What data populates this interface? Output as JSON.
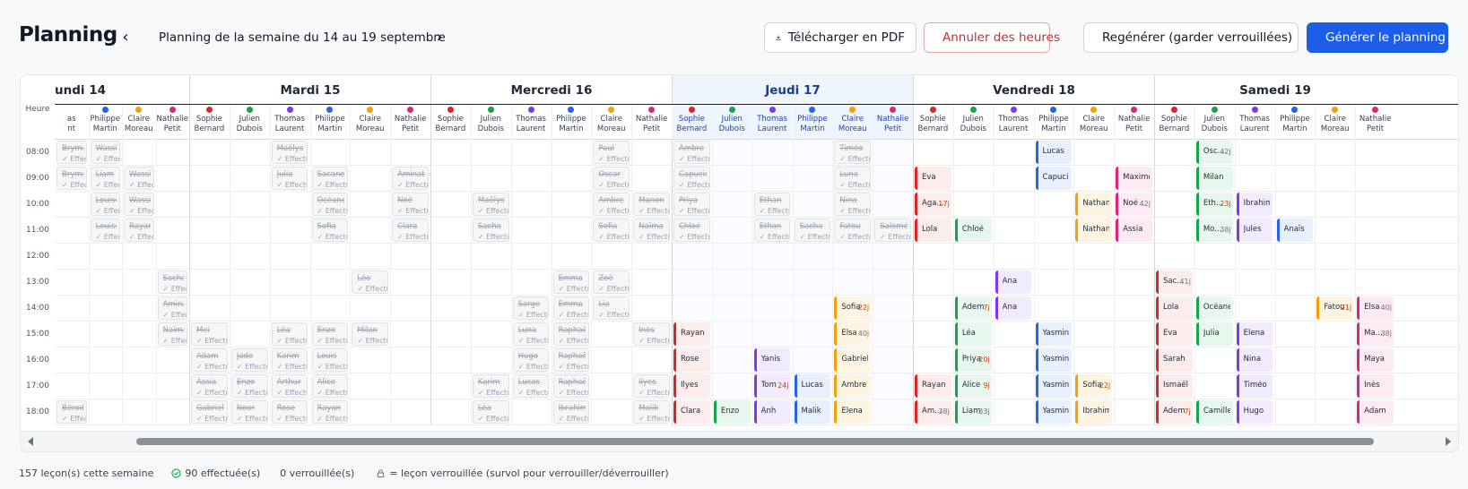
{
  "header": {
    "title": "Planning",
    "week_label": "Planning de la semaine du 14 au 19 septembre",
    "download_label": "Télécharger en PDF",
    "cancel_label": "Annuler des heures",
    "regen_label": "Regénérer (garder verrouillées)",
    "generate_label": "Générer le planning"
  },
  "colors": {
    "primary": "#1d5ee8",
    "danger": "#c53030"
  },
  "grid": {
    "heure_label": "Heure",
    "times": [
      "08:00",
      "09:00",
      "10:00",
      "11:00",
      "12:00",
      "13:00",
      "14:00",
      "15:00",
      "16:00",
      "17:00",
      "18:00"
    ],
    "done_label": "Effectu",
    "days": [
      {
        "label": "undi 14",
        "today": false
      },
      {
        "label": "Mardi 15",
        "today": false
      },
      {
        "label": "Mercredi 16",
        "today": false
      },
      {
        "label": "Jeudi 17",
        "today": true
      },
      {
        "label": "Vendredi 18",
        "today": false
      },
      {
        "label": "Samedi 19",
        "today": false
      }
    ],
    "instructors": [
      {
        "first": "Sophie",
        "last": "Bernard",
        "color": "#dc2626"
      },
      {
        "first": "Julien",
        "last": "Dubois",
        "color": "#16a34a"
      },
      {
        "first": "Thomas",
        "last": "Laurent",
        "color": "#7c3aed"
      },
      {
        "first": "Philippe",
        "last": "Martin",
        "color": "#2563eb"
      },
      {
        "first": "Claire",
        "last": "Moreau",
        "color": "#f59e0b"
      },
      {
        "first": "Nathalie",
        "last": "Petit",
        "color": "#db2777"
      }
    ],
    "monday_partial": [
      {
        "first": "",
        "last": "",
        "color": ""
      },
      {
        "first": "Philippe",
        "last": "Martin",
        "color": "#2563eb"
      },
      {
        "first": "Claire",
        "last": "Moreau",
        "color": "#f59e0b"
      },
      {
        "first": "Nathalie",
        "last": "Petit",
        "color": "#db2777"
      }
    ],
    "monday_first_partial": {
      "first": "as",
      "last": "nt"
    },
    "done_lessons": [
      {
        "day": 0,
        "col": 0,
        "row": 0,
        "name": "Bryme"
      },
      {
        "day": 0,
        "col": 1,
        "row": 0,
        "name": "Wassim"
      },
      {
        "day": 0,
        "col": 0,
        "row": 1,
        "name": "Bryme"
      },
      {
        "day": 0,
        "col": 1,
        "row": 1,
        "name": "Liam"
      },
      {
        "day": 0,
        "col": 2,
        "row": 1,
        "name": "Wassim"
      },
      {
        "day": 0,
        "col": 1,
        "row": 2,
        "name": "Louise"
      },
      {
        "day": 0,
        "col": 2,
        "row": 2,
        "name": "Wassim"
      },
      {
        "day": 0,
        "col": 1,
        "row": 3,
        "name": "Louise"
      },
      {
        "day": 0,
        "col": 2,
        "row": 3,
        "name": "Rayan"
      },
      {
        "day": 0,
        "col": 3,
        "row": 5,
        "name": "Sacha"
      },
      {
        "day": 0,
        "col": 3,
        "row": 6,
        "name": "Aminata"
      },
      {
        "day": 0,
        "col": 3,
        "row": 7,
        "name": "Naïma"
      },
      {
        "day": 0,
        "col": 0,
        "row": 10,
        "name": "Bérod"
      },
      {
        "day": 1,
        "col": 2,
        "row": 0,
        "name": "Maëlys"
      },
      {
        "day": 1,
        "col": 2,
        "row": 1,
        "name": "Julia"
      },
      {
        "day": 1,
        "col": 3,
        "row": 1,
        "name": "Sacane"
      },
      {
        "day": 1,
        "col": 5,
        "row": 1,
        "name": "Aminata"
      },
      {
        "day": 1,
        "col": 3,
        "row": 2,
        "name": "Océane"
      },
      {
        "day": 1,
        "col": 5,
        "row": 2,
        "name": "Noé"
      },
      {
        "day": 1,
        "col": 3,
        "row": 3,
        "name": "Sofia"
      },
      {
        "day": 1,
        "col": 5,
        "row": 3,
        "name": "Clara"
      },
      {
        "day": 1,
        "col": 4,
        "row": 5,
        "name": "Léo"
      },
      {
        "day": 1,
        "col": 0,
        "row": 7,
        "name": "Mei"
      },
      {
        "day": 1,
        "col": 2,
        "row": 7,
        "name": "Léa"
      },
      {
        "day": 1,
        "col": 3,
        "row": 7,
        "name": "Enzo"
      },
      {
        "day": 1,
        "col": 4,
        "row": 7,
        "name": "Milan"
      },
      {
        "day": 1,
        "col": 0,
        "row": 8,
        "name": "Adam"
      },
      {
        "day": 1,
        "col": 1,
        "row": 8,
        "name": "Jade"
      },
      {
        "day": 1,
        "col": 2,
        "row": 8,
        "name": "Karim"
      },
      {
        "day": 1,
        "col": 3,
        "row": 8,
        "name": "Louis"
      },
      {
        "day": 1,
        "col": 0,
        "row": 9,
        "name": "Assia"
      },
      {
        "day": 1,
        "col": 1,
        "row": 9,
        "name": "Enzo"
      },
      {
        "day": 1,
        "col": 2,
        "row": 9,
        "name": "Arthur"
      },
      {
        "day": 1,
        "col": 3,
        "row": 9,
        "name": "Alice"
      },
      {
        "day": 1,
        "col": 0,
        "row": 10,
        "name": "Gabriel"
      },
      {
        "day": 1,
        "col": 1,
        "row": 10,
        "name": "Noor"
      },
      {
        "day": 1,
        "col": 2,
        "row": 10,
        "name": "Rose"
      },
      {
        "day": 1,
        "col": 3,
        "row": 10,
        "name": "Rayan"
      },
      {
        "day": 2,
        "col": 4,
        "row": 0,
        "name": "Paul"
      },
      {
        "day": 2,
        "col": 4,
        "row": 1,
        "name": "Oscar"
      },
      {
        "day": 2,
        "col": 1,
        "row": 2,
        "name": "Maëlys"
      },
      {
        "day": 2,
        "col": 4,
        "row": 2,
        "name": "Ambre"
      },
      {
        "day": 2,
        "col": 5,
        "row": 2,
        "name": "Manon"
      },
      {
        "day": 2,
        "col": 1,
        "row": 3,
        "name": "Sacha"
      },
      {
        "day": 2,
        "col": 4,
        "row": 3,
        "name": "Sofia"
      },
      {
        "day": 2,
        "col": 5,
        "row": 3,
        "name": "Naïma"
      },
      {
        "day": 2,
        "col": 3,
        "row": 5,
        "name": "Emma"
      },
      {
        "day": 2,
        "col": 4,
        "row": 5,
        "name": "Zoé"
      },
      {
        "day": 2,
        "col": 2,
        "row": 6,
        "name": "Sarge"
      },
      {
        "day": 2,
        "col": 3,
        "row": 6,
        "name": "Emma"
      },
      {
        "day": 2,
        "col": 4,
        "row": 6,
        "name": "Lia"
      },
      {
        "day": 2,
        "col": 2,
        "row": 7,
        "name": "Luna"
      },
      {
        "day": 2,
        "col": 3,
        "row": 7,
        "name": "Raphaël"
      },
      {
        "day": 2,
        "col": 5,
        "row": 7,
        "name": "Inès"
      },
      {
        "day": 2,
        "col": 2,
        "row": 8,
        "name": "Hugo"
      },
      {
        "day": 2,
        "col": 3,
        "row": 8,
        "name": "Raphaël"
      },
      {
        "day": 2,
        "col": 1,
        "row": 9,
        "name": "Karim"
      },
      {
        "day": 2,
        "col": 2,
        "row": 9,
        "name": "Lucas"
      },
      {
        "day": 2,
        "col": 3,
        "row": 9,
        "name": "Raphaël"
      },
      {
        "day": 2,
        "col": 5,
        "row": 9,
        "name": "Ilyes"
      },
      {
        "day": 2,
        "col": 1,
        "row": 10,
        "name": "Léa"
      },
      {
        "day": 2,
        "col": 3,
        "row": 10,
        "name": "Ibrahim"
      },
      {
        "day": 2,
        "col": 5,
        "row": 10,
        "name": "Malik"
      },
      {
        "day": 3,
        "col": 0,
        "row": 0,
        "name": "Ambre"
      },
      {
        "day": 3,
        "col": 4,
        "row": 0,
        "name": "Timéo"
      },
      {
        "day": 3,
        "col": 0,
        "row": 1,
        "name": "Capucine"
      },
      {
        "day": 3,
        "col": 4,
        "row": 1,
        "name": "Luna"
      },
      {
        "day": 3,
        "col": 0,
        "row": 2,
        "name": "Priya"
      },
      {
        "day": 3,
        "col": 2,
        "row": 2,
        "name": "Ethan"
      },
      {
        "day": 3,
        "col": 4,
        "row": 2,
        "name": "Nina"
      },
      {
        "day": 3,
        "col": 0,
        "row": 3,
        "name": "Chloé"
      },
      {
        "day": 3,
        "col": 2,
        "row": 3,
        "name": "Ethan"
      },
      {
        "day": 3,
        "col": 3,
        "row": 3,
        "name": "Sacha"
      },
      {
        "day": 3,
        "col": 4,
        "row": 3,
        "name": "Fatou"
      },
      {
        "day": 3,
        "col": 5,
        "row": 3,
        "name": "Salomé"
      }
    ],
    "active_lessons": [
      {
        "day": 3,
        "col": 4,
        "row": 6,
        "name": "Sofia",
        "badge": "22j",
        "badge_color": "#c2410c"
      },
      {
        "day": 3,
        "col": 0,
        "row": 7,
        "name": "Rayan",
        "badge": "",
        "badge_color": ""
      },
      {
        "day": 3,
        "col": 4,
        "row": 7,
        "name": "Elsa",
        "badge": "40j",
        "badge_color": "#6b7280"
      },
      {
        "day": 3,
        "col": 0,
        "row": 8,
        "name": "Rose",
        "badge": "",
        "badge_color": ""
      },
      {
        "day": 3,
        "col": 2,
        "row": 8,
        "name": "Yanis",
        "badge": "",
        "badge_color": ""
      },
      {
        "day": 3,
        "col": 4,
        "row": 8,
        "name": "Gabriel",
        "badge": "",
        "badge_color": ""
      },
      {
        "day": 3,
        "col": 0,
        "row": 9,
        "name": "Ilyes",
        "badge": "",
        "badge_color": ""
      },
      {
        "day": 3,
        "col": 2,
        "row": 9,
        "name": "Tom",
        "badge": "24j",
        "badge_color": "#c2410c"
      },
      {
        "day": 3,
        "col": 3,
        "row": 9,
        "name": "Lucas",
        "badge": "",
        "badge_color": ""
      },
      {
        "day": 3,
        "col": 4,
        "row": 9,
        "name": "Ambre",
        "badge": "",
        "badge_color": ""
      },
      {
        "day": 3,
        "col": 0,
        "row": 10,
        "name": "Clara",
        "badge": "",
        "badge_color": ""
      },
      {
        "day": 3,
        "col": 1,
        "row": 10,
        "name": "Enzo",
        "badge": "",
        "badge_color": ""
      },
      {
        "day": 3,
        "col": 2,
        "row": 10,
        "name": "Anh",
        "badge": "",
        "badge_color": ""
      },
      {
        "day": 3,
        "col": 3,
        "row": 10,
        "name": "Malik",
        "badge": "",
        "badge_color": ""
      },
      {
        "day": 3,
        "col": 4,
        "row": 10,
        "name": "Elena",
        "badge": "",
        "badge_color": ""
      },
      {
        "day": 4,
        "col": 3,
        "row": 0,
        "name": "Lucas",
        "badge": "",
        "badge_color": ""
      },
      {
        "day": 4,
        "col": 0,
        "row": 1,
        "name": "Eva",
        "badge": "",
        "badge_color": ""
      },
      {
        "day": 4,
        "col": 3,
        "row": 1,
        "name": "Capucine",
        "badge": "",
        "badge_color": ""
      },
      {
        "day": 4,
        "col": 5,
        "row": 1,
        "name": "Maxime",
        "badge": "",
        "badge_color": ""
      },
      {
        "day": 4,
        "col": 0,
        "row": 2,
        "name": "Aga...",
        "badge": "17j",
        "badge_color": "#c2410c"
      },
      {
        "day": 4,
        "col": 4,
        "row": 2,
        "name": "Nathan",
        "badge": "",
        "badge_color": ""
      },
      {
        "day": 4,
        "col": 5,
        "row": 2,
        "name": "Noé",
        "badge": "42j",
        "badge_color": "#6b7280"
      },
      {
        "day": 4,
        "col": 0,
        "row": 3,
        "name": "Lola",
        "badge": "",
        "badge_color": ""
      },
      {
        "day": 4,
        "col": 1,
        "row": 3,
        "name": "Chloé",
        "badge": "",
        "badge_color": ""
      },
      {
        "day": 4,
        "col": 4,
        "row": 3,
        "name": "Nathan",
        "badge": "",
        "badge_color": ""
      },
      {
        "day": 4,
        "col": 5,
        "row": 3,
        "name": "Assia",
        "badge": "",
        "badge_color": ""
      },
      {
        "day": 4,
        "col": 2,
        "row": 5,
        "name": "Ana",
        "badge": "",
        "badge_color": ""
      },
      {
        "day": 4,
        "col": 1,
        "row": 6,
        "name": "Adem",
        "badge": "7j",
        "badge_color": "#c2410c"
      },
      {
        "day": 4,
        "col": 2,
        "row": 6,
        "name": "Ana",
        "badge": "",
        "badge_color": ""
      },
      {
        "day": 4,
        "col": 1,
        "row": 7,
        "name": "Léa",
        "badge": "",
        "badge_color": ""
      },
      {
        "day": 4,
        "col": 3,
        "row": 7,
        "name": "Yasmine",
        "badge": "",
        "badge_color": ""
      },
      {
        "day": 4,
        "col": 1,
        "row": 8,
        "name": "Priya",
        "badge": "20j",
        "badge_color": "#c2410c"
      },
      {
        "day": 4,
        "col": 3,
        "row": 8,
        "name": "Yasmine",
        "badge": "",
        "badge_color": ""
      },
      {
        "day": 4,
        "col": 0,
        "row": 9,
        "name": "Rayan",
        "badge": "",
        "badge_color": ""
      },
      {
        "day": 4,
        "col": 1,
        "row": 9,
        "name": "Alice",
        "badge": "9j",
        "badge_color": "#c2410c"
      },
      {
        "day": 4,
        "col": 3,
        "row": 9,
        "name": "Yasmine",
        "badge": "",
        "badge_color": ""
      },
      {
        "day": 4,
        "col": 4,
        "row": 9,
        "name": "Sofia",
        "badge": "22j",
        "badge_color": "#c2410c"
      },
      {
        "day": 4,
        "col": 0,
        "row": 10,
        "name": "Am...",
        "badge": "38j",
        "badge_color": "#6b7280"
      },
      {
        "day": 4,
        "col": 1,
        "row": 10,
        "name": "Liam",
        "badge": "33j",
        "badge_color": "#6b7280"
      },
      {
        "day": 4,
        "col": 3,
        "row": 10,
        "name": "Yasmine",
        "badge": "",
        "badge_color": ""
      },
      {
        "day": 4,
        "col": 4,
        "row": 10,
        "name": "Ibrahim",
        "badge": "",
        "badge_color": ""
      },
      {
        "day": 5,
        "col": 1,
        "row": 0,
        "name": "Osc...",
        "badge": "42j",
        "badge_color": "#6b7280"
      },
      {
        "day": 5,
        "col": 1,
        "row": 1,
        "name": "Milan",
        "badge": "",
        "badge_color": ""
      },
      {
        "day": 5,
        "col": 1,
        "row": 2,
        "name": "Eth...",
        "badge": "23j",
        "badge_color": "#c2410c"
      },
      {
        "day": 5,
        "col": 2,
        "row": 2,
        "name": "Ibrahim",
        "badge": "",
        "badge_color": ""
      },
      {
        "day": 5,
        "col": 1,
        "row": 3,
        "name": "Mo...",
        "badge": "38j",
        "badge_color": "#6b7280"
      },
      {
        "day": 5,
        "col": 2,
        "row": 3,
        "name": "Jules",
        "badge": "",
        "badge_color": ""
      },
      {
        "day": 5,
        "col": 3,
        "row": 3,
        "name": "Anaïs",
        "badge": "",
        "badge_color": ""
      },
      {
        "day": 5,
        "col": 0,
        "row": 5,
        "name": "Sac...",
        "badge": "41j",
        "badge_color": "#6b7280"
      },
      {
        "day": 5,
        "col": 0,
        "row": 6,
        "name": "Lola",
        "badge": "",
        "badge_color": ""
      },
      {
        "day": 5,
        "col": 1,
        "row": 6,
        "name": "Océane",
        "badge": "",
        "badge_color": ""
      },
      {
        "day": 5,
        "col": 4,
        "row": 6,
        "name": "Fatou",
        "badge": "21j",
        "badge_color": "#c2410c"
      },
      {
        "day": 5,
        "col": 5,
        "row": 6,
        "name": "Elsa",
        "badge": "40j",
        "badge_color": "#6b7280"
      },
      {
        "day": 5,
        "col": 0,
        "row": 7,
        "name": "Eva",
        "badge": "",
        "badge_color": ""
      },
      {
        "day": 5,
        "col": 1,
        "row": 7,
        "name": "Julia",
        "badge": "",
        "badge_color": ""
      },
      {
        "day": 5,
        "col": 2,
        "row": 7,
        "name": "Elena",
        "badge": "",
        "badge_color": ""
      },
      {
        "day": 5,
        "col": 5,
        "row": 7,
        "name": "Ma...",
        "badge": "38j",
        "badge_color": "#6b7280"
      },
      {
        "day": 5,
        "col": 0,
        "row": 8,
        "name": "Sarah",
        "badge": "",
        "badge_color": ""
      },
      {
        "day": 5,
        "col": 2,
        "row": 8,
        "name": "Nina",
        "badge": "",
        "badge_color": ""
      },
      {
        "day": 5,
        "col": 5,
        "row": 8,
        "name": "Maya",
        "badge": "",
        "badge_color": ""
      },
      {
        "day": 5,
        "col": 0,
        "row": 9,
        "name": "Ismaël",
        "badge": "",
        "badge_color": ""
      },
      {
        "day": 5,
        "col": 2,
        "row": 9,
        "name": "Timéo",
        "badge": "",
        "badge_color": ""
      },
      {
        "day": 5,
        "col": 5,
        "row": 9,
        "name": "Inès",
        "badge": "",
        "badge_color": ""
      },
      {
        "day": 5,
        "col": 0,
        "row": 10,
        "name": "Adem",
        "badge": "7j",
        "badge_color": "#c2410c"
      },
      {
        "day": 5,
        "col": 1,
        "row": 10,
        "name": "Camille",
        "badge": "",
        "badge_color": ""
      },
      {
        "day": 5,
        "col": 2,
        "row": 10,
        "name": "Hugo",
        "badge": "",
        "badge_color": ""
      },
      {
        "day": 5,
        "col": 5,
        "row": 10,
        "name": "Adam",
        "badge": "",
        "badge_color": ""
      }
    ]
  },
  "footer": {
    "lessons_count": "157 leçon(s) cette semaine",
    "done_count": "90 effectuée(s)",
    "locked_count": "0 verrouillée(s)",
    "lock_legend": "= leçon verrouillée (survol pour verrouiller/déverrouiller)"
  }
}
